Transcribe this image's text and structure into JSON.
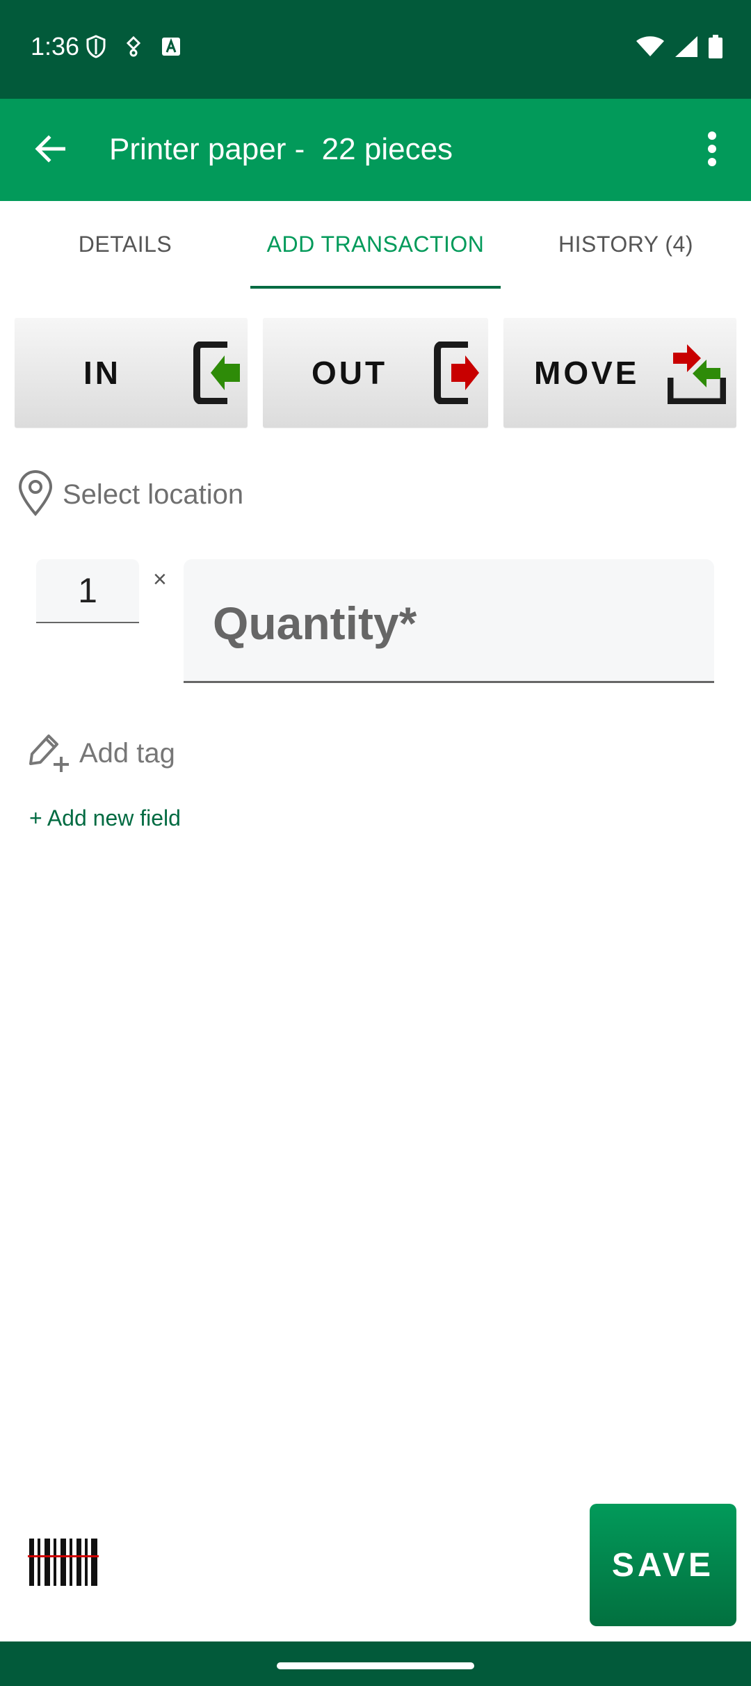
{
  "status_bar": {
    "time": "1:36",
    "icons_left": [
      "shield-icon",
      "vpn-key-icon",
      "text-a-icon"
    ],
    "icons_right": [
      "wifi-icon",
      "cell-signal-icon",
      "battery-icon"
    ],
    "color": "#025a3a"
  },
  "app_bar": {
    "title": "Printer paper -  22 pieces",
    "color": "#029a5a",
    "icons": [
      "back-arrow-icon",
      "more-vert-icon"
    ]
  },
  "tabs": [
    {
      "label": "DETAILS",
      "active": false
    },
    {
      "label": "ADD TRANSACTION",
      "active": true
    },
    {
      "label": "HISTORY (4)",
      "active": false
    }
  ],
  "transaction_types": [
    {
      "label": "IN",
      "icon": "enter-arrow-icon"
    },
    {
      "label": "OUT",
      "icon": "exit-arrow-icon"
    },
    {
      "label": "MOVE",
      "icon": "move-arrows-icon"
    }
  ],
  "location": {
    "label": "Select location",
    "icon": "location-pin-icon"
  },
  "quantity": {
    "multiplier": "1",
    "times": "×",
    "placeholder": "Quantity*"
  },
  "tag": {
    "label": "Add tag",
    "icon": "add-tag-icon"
  },
  "add_field": {
    "label": "+ Add new field"
  },
  "bottom": {
    "save_label": "SAVE",
    "barcode_icon": "barcode-scan-icon"
  },
  "accent_color": "#026b42"
}
